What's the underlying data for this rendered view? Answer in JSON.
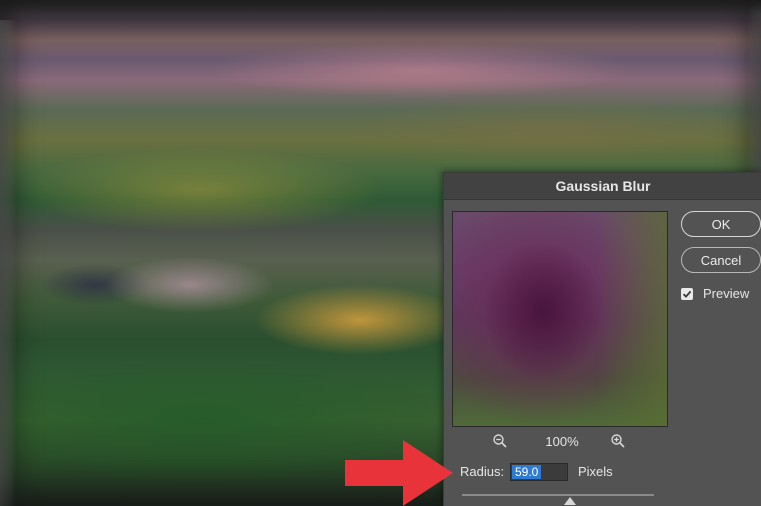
{
  "dialog": {
    "title": "Gaussian Blur",
    "ok_label": "OK",
    "cancel_label": "Cancel",
    "preview_label": "Preview",
    "preview_checked": true,
    "zoom_level": "100%",
    "radius_label": "Radius:",
    "radius_value": "59.0",
    "radius_unit": "Pixels"
  },
  "icons": {
    "zoom_out": "zoom-out-icon",
    "zoom_in": "zoom-in-icon",
    "checkmark": "checkmark-icon",
    "annotation_arrow": "right-arrow-icon"
  },
  "colors": {
    "dialog_bg": "#535353",
    "title_bar": "#424242",
    "selection": "#2d7bd6",
    "annotation_arrow": "#e8333a"
  }
}
